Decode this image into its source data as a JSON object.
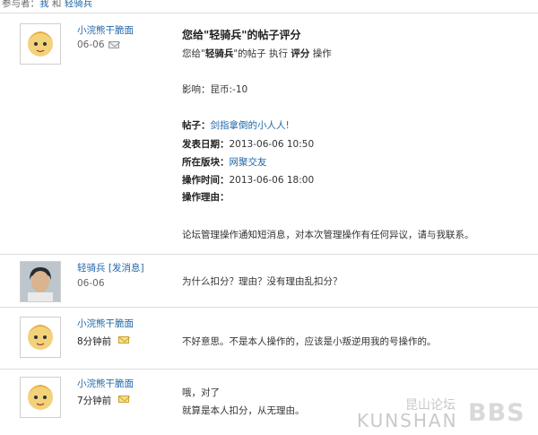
{
  "participants": {
    "prefix": "参与者：",
    "me": "我",
    "and": "和",
    "other": "轻骑兵"
  },
  "messages": [
    {
      "sender": "小浣熊干脆面",
      "date": "06-06",
      "title": "您给\"轻骑兵\"的帖子评分",
      "subtitle_pre": "您给\"",
      "subtitle_name": "轻骑兵",
      "subtitle_mid": "\"的帖子 执行 ",
      "subtitle_action": "评分",
      "subtitle_post": " 操作",
      "effect": "影响：昆币:-10",
      "post_label": "帖子：",
      "post_value": "剑指拿倒的小人人!",
      "publish_label": "发表日期：",
      "publish_value": "2013-06-06 10:50",
      "board_label": "所在版块：",
      "board_value": "网聚交友",
      "optime_label": "操作时间：",
      "optime_value": "2013-06-06 18:00",
      "reason_label": "操作理由：",
      "notice": "论坛管理操作通知短消息，对本次管理操作有任何异议，请与我联系。"
    },
    {
      "sender": "轻骑兵",
      "send_link": "[发消息]",
      "date": "06-06",
      "text": "为什么扣分？理由？没有理由乱扣分？"
    },
    {
      "sender": "小浣熊干脆面",
      "date": "8分钟前",
      "text": "不好意思。不是本人操作的，应该是小叛逆用我的号操作的。"
    },
    {
      "sender": "小浣熊干脆面",
      "date": "7分钟前",
      "line1": "哦，对了",
      "line2": "就算是本人扣分，从无理由。"
    }
  ],
  "watermark": {
    "cn": "昆山论坛",
    "en": "KUNSHAN",
    "bbs": "BBS"
  },
  "colors": {
    "link": "#1f66a8",
    "divider": "#dcdcdc",
    "mail_icon_unread": "#f7e08a"
  }
}
